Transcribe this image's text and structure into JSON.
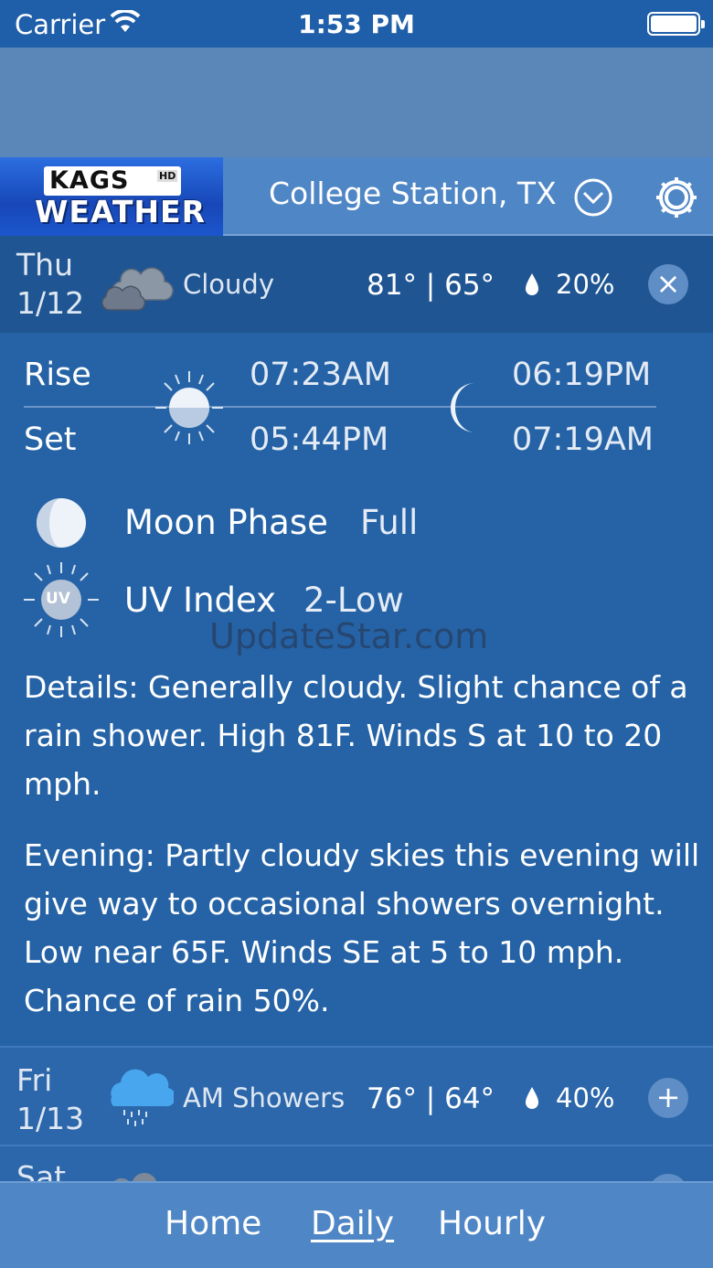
{
  "status_bar": {
    "carrier": "Carrier",
    "time": "1:53 PM"
  },
  "header": {
    "logo_top": "KAGS",
    "logo_badge": "HD",
    "logo_bottom": "WEATHER",
    "location": "College Station, TX"
  },
  "today": {
    "day": "Thu",
    "date": "1/12",
    "icon": "cloudy-icon",
    "condition": "Cloudy",
    "temps": "81° | 65°",
    "precip": "20%",
    "toggle": "×"
  },
  "sun_moon": {
    "rise_label": "Rise",
    "set_label": "Set",
    "sunrise": "07:23AM",
    "sunset": "05:44PM",
    "moonrise": "06:19PM",
    "moonset": "07:19AM"
  },
  "moon_phase": {
    "label": "Moon Phase",
    "value": "Full"
  },
  "uv_index": {
    "label": "UV Index",
    "value": "2-Low",
    "icon_text": "UV"
  },
  "watermark": "UpdateStar.com",
  "details": "Details: Generally cloudy. Slight chance of a rain shower. High 81F. Winds S at 10 to 20 mph.",
  "evening": "Evening: Partly cloudy skies this evening will give way to occasional showers overnight. Low near 65F. Winds SE at 5 to 10 mph. Chance of rain 50%.",
  "forecast": [
    {
      "day": "Fri",
      "date": "1/13",
      "icon": "rain-cloud-icon",
      "condition": "AM Showers",
      "temps": "76° | 64°",
      "precip": "40%",
      "toggle": "+"
    },
    {
      "day": "Sat",
      "date": "",
      "icon": "cloudy-icon",
      "condition": "",
      "temps": "",
      "precip": "",
      "toggle": ""
    }
  ],
  "tabs": [
    {
      "label": "Home",
      "active": false
    },
    {
      "label": "Daily",
      "active": true
    },
    {
      "label": "Hourly",
      "active": false
    }
  ],
  "colors": {
    "accent": "#2563a6",
    "header": "#4f86c6",
    "summary": "#1f5592"
  }
}
